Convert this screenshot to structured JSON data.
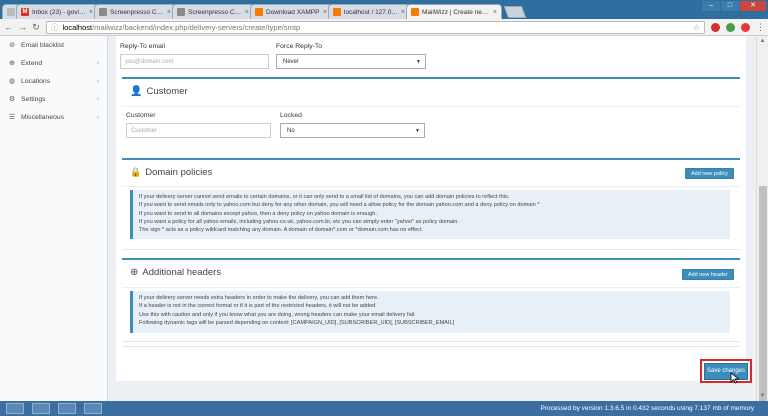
{
  "browser": {
    "tabs": [
      {
        "title": "Inbox (23) - govin28@...",
        "icon_color": "#d93025",
        "icon": "mail-icon"
      },
      {
        "title": "Screenpresso Cloud",
        "icon_color": "#8a8a8a",
        "icon": "document-icon"
      },
      {
        "title": "Screenpresso Cloud",
        "icon_color": "#8a8a8a",
        "icon": "document-icon"
      },
      {
        "title": "Download XAMPP",
        "icon_color": "#f57c00",
        "icon": "xampp-icon"
      },
      {
        "title": "localhost / 127.0.0.1 | ph...",
        "icon_color": "#f57c00",
        "icon": "phpmyadmin-icon"
      },
      {
        "title": "MailWizz | Create new s...",
        "icon_color": "#f57c00",
        "icon": "mailwizz-icon"
      }
    ],
    "url_host": "localhost",
    "url_path": "/mailwizz/backend/index.php/delivery-servers/create/type/smtp"
  },
  "sidebar": {
    "items": [
      {
        "label": "Email blacklist",
        "icon": "ban-icon",
        "has_chevron": false
      },
      {
        "label": "Extend",
        "icon": "plus-icon",
        "has_chevron": true
      },
      {
        "label": "Locations",
        "icon": "globe-icon",
        "has_chevron": true
      },
      {
        "label": "Settings",
        "icon": "gear-icon",
        "has_chevron": true
      },
      {
        "label": "Miscellaneous",
        "icon": "list-icon",
        "has_chevron": true
      }
    ]
  },
  "form": {
    "reply_to_label": "Reply-To email",
    "reply_to_placeholder": "you@domain.com",
    "force_reply_label": "Force Reply-To",
    "force_reply_value": "Never",
    "customer_section_title": "Customer",
    "customer_label": "Customer",
    "customer_placeholder": "Customer",
    "locked_label": "Locked",
    "locked_value": "No",
    "domain_section_title": "Domain policies",
    "add_policy_label": "Add new policy",
    "domain_info": [
      "If your delivery server cannot send emails to certain domains, or it can only send to a small list of domains, you can add domain policies to reflect this.",
      "If you want to send emails only to yahoo.com but deny for any other domain, you will need a allow policy for the domain yahoo.com and a deny policy on domain *",
      "If you want to send to all domains except yahoo, then a deny policy on yahoo domain is enough.",
      "If you want a policy for all yahoo emails, including yahoo.co.uk, yahoo.com.br, etc you can simply enter \"yahoo\" as policy domain.",
      "The sign * acts as a policy wildcard matching any domain. A domain of domain*.com or *domain.com has no effect."
    ],
    "headers_section_title": "Additional headers",
    "add_header_label": "Add new header",
    "headers_info": [
      "If your delivery server needs extra headers in order to make the delivery, you can add them here.",
      "If a header is not in the correct format or if it is part of the restricted headers, it will not be added.",
      "Use this with caution and only if you know what you are doing, wrong headers can make your email delivery fail.",
      "Following dynamic tags will be parsed depending on context: [CAMPAIGN_UID], [SUBSCRIBER_UID], [SUBSCRIBER_EMAIL]"
    ],
    "save_label": "Save changes"
  },
  "footer": {
    "text": "Processed by version 1.3.6.5 in 0.432 seconds using 7.137 mb of memory"
  },
  "colors": {
    "accent": "#3c8dbc",
    "highlight": "#d52b2b"
  }
}
